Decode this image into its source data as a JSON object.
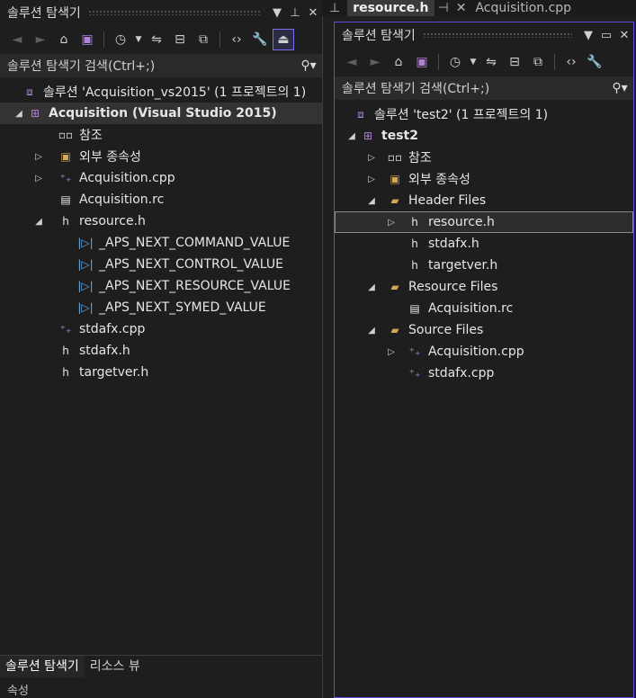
{
  "colors": {
    "accent": "#7b6ef0",
    "vs_purple": "#b180d7",
    "folder": "#d8a657",
    "file_icon": "#dcdcdc"
  },
  "left": {
    "title": "솔루션 탐색기",
    "search_placeholder": "솔루션 탐색기 검색(Ctrl+;)",
    "solution": "솔루션 'Acquisition_vs2015' (1 프로젝트의 1)",
    "project": "Acquisition (Visual Studio 2015)",
    "items": [
      {
        "label": "참조",
        "icon": "references-icon"
      },
      {
        "label": "외부 종속성",
        "icon": "external-deps-icon"
      },
      {
        "label": "Acquisition.cpp",
        "icon": "cpp-file-icon"
      },
      {
        "label": "Acquisition.rc",
        "icon": "rc-file-icon"
      },
      {
        "label": "resource.h",
        "icon": "h-file-icon"
      },
      {
        "label": "_APS_NEXT_COMMAND_VALUE",
        "icon": "macro-icon"
      },
      {
        "label": "_APS_NEXT_CONTROL_VALUE",
        "icon": "macro-icon"
      },
      {
        "label": "_APS_NEXT_RESOURCE_VALUE",
        "icon": "macro-icon"
      },
      {
        "label": "_APS_NEXT_SYMED_VALUE",
        "icon": "macro-icon"
      },
      {
        "label": "stdafx.cpp",
        "icon": "cpp-file-icon"
      },
      {
        "label": "stdafx.h",
        "icon": "h-file-icon"
      },
      {
        "label": "targetver.h",
        "icon": "h-file-icon"
      }
    ],
    "bottom_tabs": [
      "솔루션 탐색기",
      "리소스 뷰"
    ],
    "bottom_label": "속성"
  },
  "right": {
    "top_tabs": [
      "resource.h",
      "Acquisition.cpp"
    ],
    "title": "솔루션 탐색기",
    "search_placeholder": "솔루션 탐색기 검색(Ctrl+;)",
    "solution": "솔루션 'test2' (1 프로젝트의 1)",
    "project": "test2",
    "items": [
      {
        "label": "참조"
      },
      {
        "label": "외부 종속성"
      },
      {
        "label": "Header Files"
      },
      {
        "label": "resource.h"
      },
      {
        "label": "stdafx.h"
      },
      {
        "label": "targetver.h"
      },
      {
        "label": "Resource Files"
      },
      {
        "label": "Acquisition.rc"
      },
      {
        "label": "Source Files"
      },
      {
        "label": "Acquisition.cpp"
      },
      {
        "label": "stdafx.cpp"
      }
    ]
  }
}
